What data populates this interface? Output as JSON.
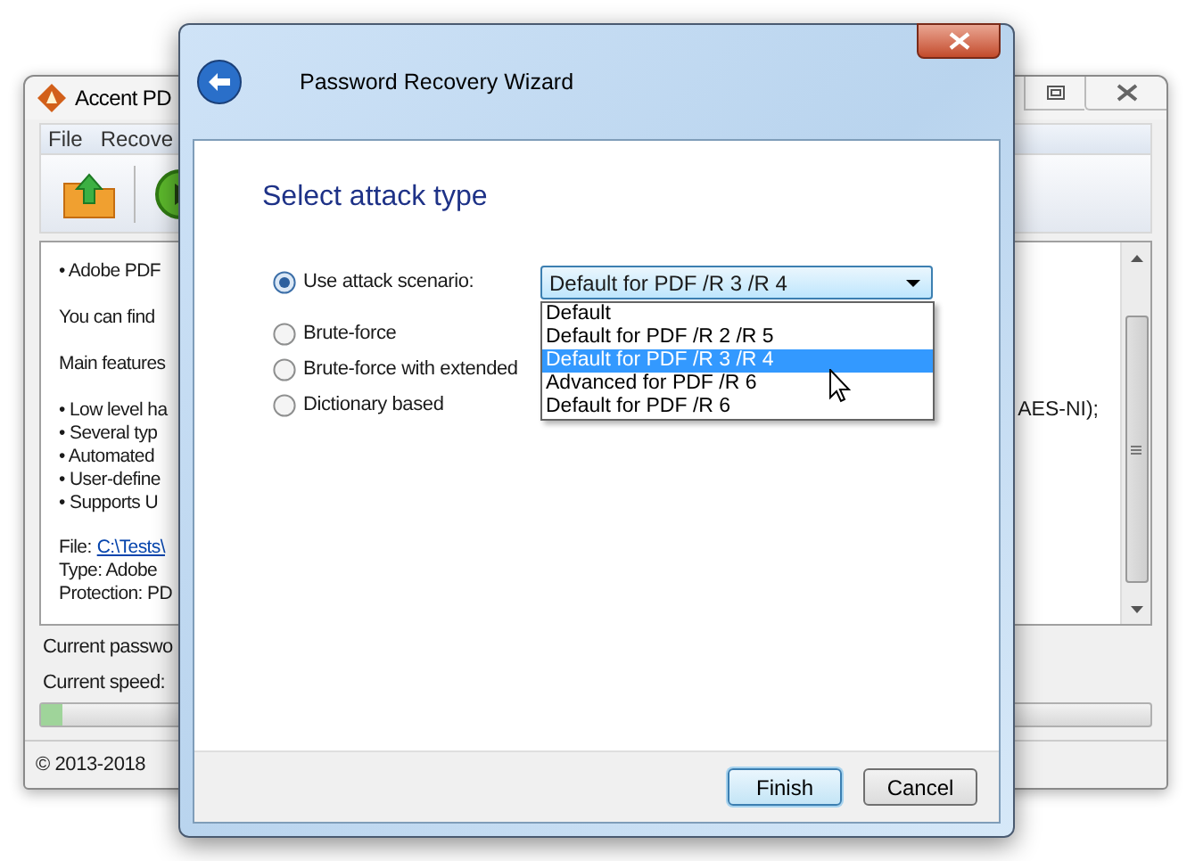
{
  "background_window": {
    "title": "Accent PD",
    "menu": [
      "File",
      "Recove"
    ],
    "lines": [
      {
        "text": "• Adobe PDF",
        "kind": "bullet"
      },
      {
        "text": "You can find",
        "kind": "paragraph"
      },
      {
        "text": "Main features",
        "kind": "paragraph"
      },
      {
        "text": "• Low level ha",
        "kind": "bullet",
        "tail": "AES-NI);"
      },
      {
        "text": "• Several typ",
        "kind": "bullet"
      },
      {
        "text": "• Automated",
        "kind": "bullet"
      },
      {
        "text": "• User-define",
        "kind": "bullet"
      },
      {
        "text": "• Supports U",
        "kind": "bullet"
      }
    ],
    "file_label": "File:",
    "file_link": "C:\\Tests\\",
    "type": "Type: Adobe",
    "protection": "Protection: PD",
    "current_password": "Current passwo",
    "current_speed": "Current speed:",
    "progress": {
      "level": 0.02
    },
    "footer": "© 2013-2018"
  },
  "dialog": {
    "title": "Password Recovery Wizard",
    "heading": "Select attack type",
    "options": [
      {
        "label": "Use attack scenario:",
        "selected": true
      },
      {
        "label": "Brute-force",
        "selected": false
      },
      {
        "label": "Brute-force with extended",
        "selected": false
      },
      {
        "label": "Dictionary based",
        "selected": false
      }
    ],
    "combo": {
      "value": "Default for PDF /R 3 /R 4",
      "items": [
        {
          "label": "Default",
          "selected": false
        },
        {
          "label": "Default for PDF /R 2 /R 5",
          "selected": false
        },
        {
          "label": "Default for PDF /R 3 /R 4",
          "selected": true
        },
        {
          "label": "Advanced for PDF /R 6",
          "selected": false
        },
        {
          "label": "Default for PDF /R 6",
          "selected": false
        }
      ]
    },
    "buttons": [
      {
        "label": "Finish",
        "default": true
      },
      {
        "label": "Cancel",
        "default": false
      }
    ]
  }
}
